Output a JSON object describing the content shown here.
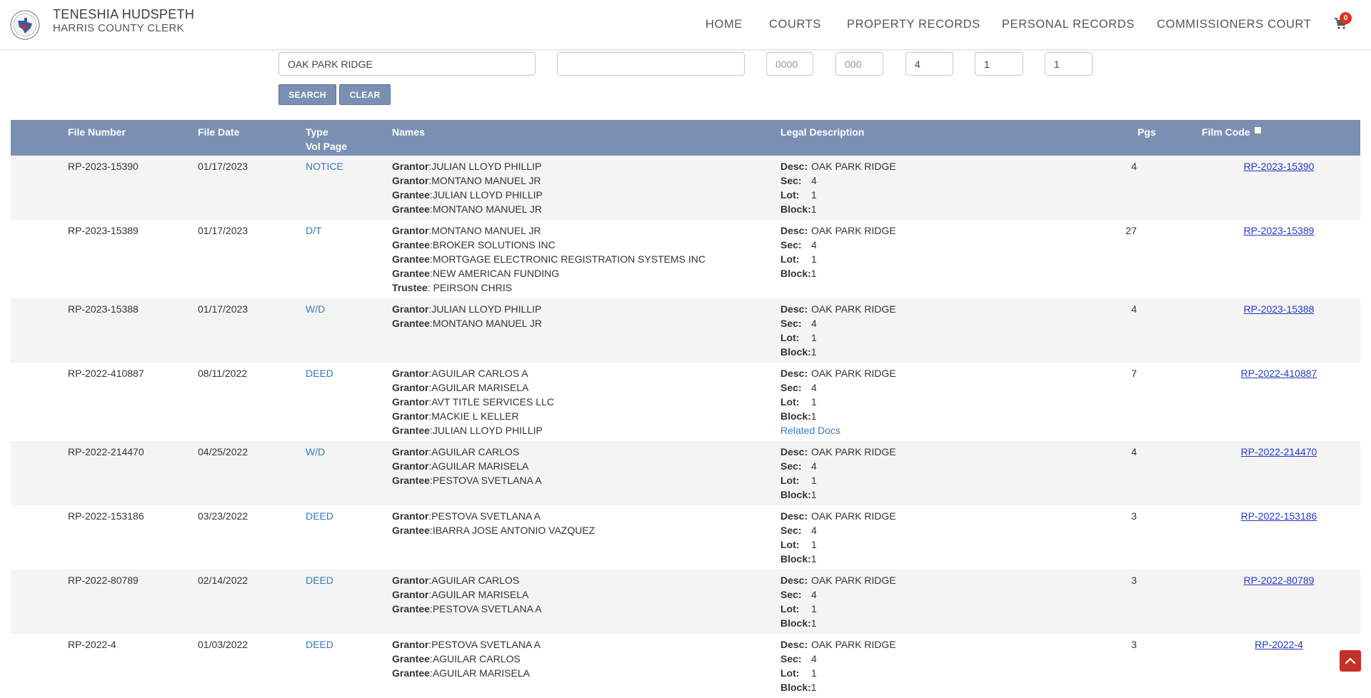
{
  "header": {
    "clerk_name": "TENESHIA HUDSPETH",
    "office": "HARRIS COUNTY CLERK",
    "nav": [
      "HOME",
      "COURTS",
      "PROPERTY RECORDS",
      "PERSONAL RECORDS",
      "COMMISSIONERS COURT"
    ],
    "cart_count": "0"
  },
  "search": {
    "subdivision_value": "OAK PARK RIDGE",
    "field2_value": "",
    "vol_placeholder": "0000",
    "page_placeholder": "000",
    "section_value": "4",
    "lot_value": "1",
    "block_value": "1",
    "search_label": "SEARCH",
    "clear_label": "CLEAR"
  },
  "table": {
    "headers": {
      "file_number": "File Number",
      "file_date": "File Date",
      "type": "Type",
      "vol_page": "Vol Page",
      "names": "Names",
      "legal": "Legal Description",
      "pgs": "Pgs",
      "film_code": "Film Code"
    },
    "legal_labels": {
      "desc": "Desc:",
      "sec": "Sec:",
      "lot": "Lot:",
      "block": "Block:"
    },
    "rows": [
      {
        "file": "RP-2023-15390",
        "date": "01/17/2023",
        "type": "NOTICE",
        "names": [
          [
            "Grantor",
            "JULIAN LLOYD PHILLIP"
          ],
          [
            "Grantor",
            "MONTANO MANUEL JR"
          ],
          [
            "Grantee",
            "JULIAN LLOYD PHILLIP"
          ],
          [
            "Grantee",
            "MONTANO MANUEL JR"
          ]
        ],
        "desc": "OAK PARK RIDGE",
        "sec": "4",
        "lot": "1",
        "block": "1",
        "pgs": "4",
        "film": "RP-2023-15390"
      },
      {
        "file": "RP-2023-15389",
        "date": "01/17/2023",
        "type": "D/T",
        "names": [
          [
            "Grantor",
            "MONTANO MANUEL JR"
          ],
          [
            "Grantee",
            "BROKER SOLUTIONS INC"
          ],
          [
            "Grantee",
            "MORTGAGE ELECTRONIC REGISTRATION SYSTEMS INC"
          ],
          [
            "Grantee",
            "NEW AMERICAN FUNDING"
          ],
          [
            "Trustee",
            " PEIRSON CHRIS"
          ]
        ],
        "desc": "OAK PARK RIDGE",
        "sec": "4",
        "lot": "1",
        "block": "1",
        "pgs": "27",
        "film": "RP-2023-15389"
      },
      {
        "file": "RP-2023-15388",
        "date": "01/17/2023",
        "type": "W/D",
        "names": [
          [
            "Grantor",
            "JULIAN LLOYD PHILLIP"
          ],
          [
            "Grantee",
            "MONTANO MANUEL JR"
          ]
        ],
        "desc": "OAK PARK RIDGE",
        "sec": "4",
        "lot": "1",
        "block": "1",
        "pgs": "4",
        "film": "RP-2023-15388"
      },
      {
        "file": "RP-2022-410887",
        "date": "08/11/2022",
        "type": "DEED",
        "names": [
          [
            "Grantor",
            "AGUILAR CARLOS A"
          ],
          [
            "Grantor",
            "AGUILAR MARISELA"
          ],
          [
            "Grantor",
            "AVT TITLE SERVICES LLC"
          ],
          [
            "Grantor",
            "MACKIE L KELLER"
          ],
          [
            "Grantee",
            "JULIAN LLOYD PHILLIP"
          ]
        ],
        "desc": "OAK PARK RIDGE",
        "sec": "4",
        "lot": "1",
        "block": "1",
        "related": "Related Docs",
        "pgs": "7",
        "film": "RP-2022-410887"
      },
      {
        "file": "RP-2022-214470",
        "date": "04/25/2022",
        "type": "W/D",
        "names": [
          [
            "Grantor",
            "AGUILAR CARLOS"
          ],
          [
            "Grantor",
            "AGUILAR MARISELA"
          ],
          [
            "Grantee",
            "PESTOVA SVETLANA A"
          ]
        ],
        "desc": "OAK PARK RIDGE",
        "sec": "4",
        "lot": "1",
        "block": "1",
        "pgs": "4",
        "film": "RP-2022-214470"
      },
      {
        "file": "RP-2022-153186",
        "date": "03/23/2022",
        "type": "DEED",
        "names": [
          [
            "Grantor",
            "PESTOVA SVETLANA A"
          ],
          [
            "Grantee",
            "IBARRA JOSE ANTONIO VAZQUEZ"
          ]
        ],
        "desc": "OAK PARK RIDGE",
        "sec": "4",
        "lot": "1",
        "block": "1",
        "pgs": "3",
        "film": "RP-2022-153186"
      },
      {
        "file": "RP-2022-80789",
        "date": "02/14/2022",
        "type": "DEED",
        "names": [
          [
            "Grantor",
            "AGUILAR CARLOS"
          ],
          [
            "Grantor",
            "AGUILAR MARISELA"
          ],
          [
            "Grantee",
            "PESTOVA SVETLANA A"
          ]
        ],
        "desc": "OAK PARK RIDGE",
        "sec": "4",
        "lot": "1",
        "block": "1",
        "pgs": "3",
        "film": "RP-2022-80789"
      },
      {
        "file": "RP-2022-4",
        "date": "01/03/2022",
        "type": "DEED",
        "names": [
          [
            "Grantor",
            "PESTOVA SVETLANA A"
          ],
          [
            "Grantee",
            "AGUILAR CARLOS"
          ],
          [
            "Grantee",
            "AGUILAR MARISELA"
          ]
        ],
        "desc": "OAK PARK RIDGE",
        "sec": "4",
        "lot": "1",
        "block": "1",
        "pgs": "3",
        "film": "RP-2022-4"
      }
    ]
  },
  "colors": {
    "header_bg": "#7a90b3",
    "link_blue": "#3a79b7",
    "film_link": "#2338c9",
    "badge_red": "#d9341f"
  },
  "icons": {
    "cart": "shopping-cart-icon",
    "seal": "county-seal-icon",
    "scroll_top": "chevron-up-icon"
  }
}
